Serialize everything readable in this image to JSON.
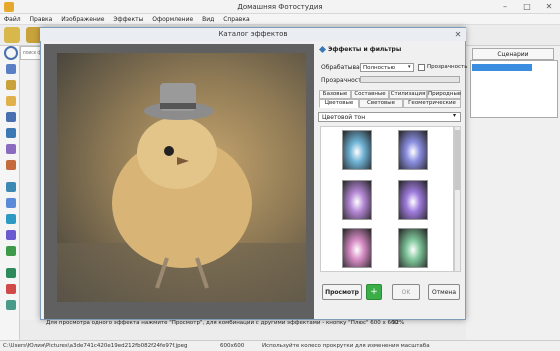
{
  "app": {
    "title": "Домашняя Фотостудия"
  },
  "menu": [
    "Файл",
    "Правка",
    "Изображение",
    "Эффекты",
    "Оформление",
    "Вид",
    "Справка"
  ],
  "search": {
    "placeholder": "поиск ф"
  },
  "right_panel": {
    "tab": "Сценарии"
  },
  "dialog": {
    "title": "Каталог эффектов",
    "panel_title": "Эффекты и фильтры",
    "process_label": "Обрабатывать:",
    "process_value": "Полностью",
    "transparency_check": "Прозрачность",
    "transparency_label": "Прозрачность:",
    "tabs_row1": [
      "Базовые",
      "Составные",
      "Стилизация",
      "Природные"
    ],
    "tabs_row2": [
      "Цветовые",
      "Световые",
      "Геометрические"
    ],
    "filter_value": "Цветовой тон",
    "thumbnail_tints": [
      "#6fb3d6",
      "#8a8ee0",
      "#b588d6",
      "#9e7bdc",
      "#d58bc4",
      "#7fc59a"
    ],
    "buttons": {
      "preview": "Просмотр",
      "ok": "OK",
      "cancel": "Отмена"
    },
    "hint": "Для просмотра одного эффекта нажмите \"Просмотр\", для комбинации с другими эффектами - кнопку \"Плюс\"   600 x 600",
    "zoom": "92%"
  },
  "statusbar": {
    "path": "C:\\Users\\Юлия\\Pictures\\a3de741c420e19ed212fb082f24fe97f.jpeg",
    "size": "600x600",
    "hint": "Используйте колесо прокрутки для изменения масштаба"
  }
}
